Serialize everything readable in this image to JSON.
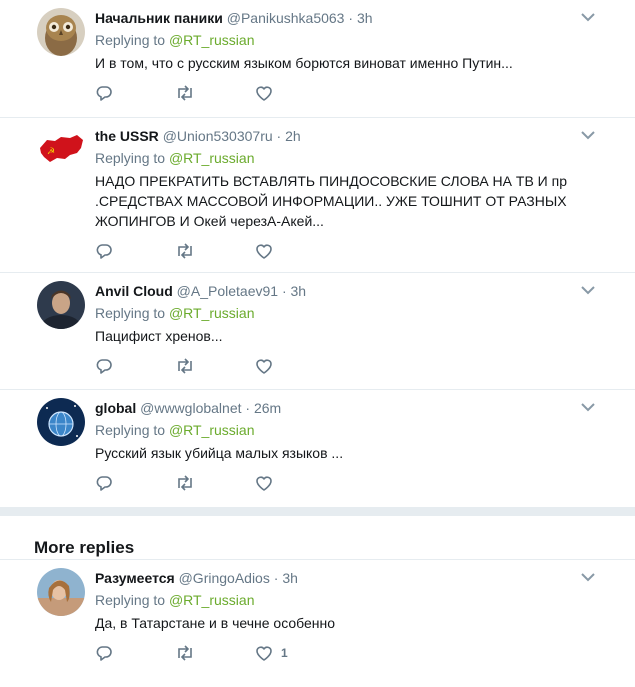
{
  "replies": [
    {
      "name": "Начальник паники",
      "handle": "@Panikushka5063",
      "time": "3h",
      "replying_label": "Replying to",
      "replying_to": "@RT_russian",
      "text": "И в том, что с русским языком борются виноват именно Путин...",
      "avatar": "owl-avatar",
      "like_count": ""
    },
    {
      "name": "the USSR",
      "handle": "@Union530307ru",
      "time": "2h",
      "replying_label": "Replying to",
      "replying_to": "@RT_russian",
      "text": "НАДО ПРЕКРАТИТЬ ВСТАВЛЯТЬ ПИНДОСОВСКИЕ СЛОВА НА ТВ И пр .СРЕДСТВАХ МАССОВОЙ ИНФОРМАЦИИ.. УЖЕ ТОШНИТ ОТ РАЗНЫХ ЖОПИНГОВ И Окей черезА-Акей...",
      "avatar": "ussr-map-avatar",
      "like_count": ""
    },
    {
      "name": "Anvil Cloud",
      "handle": "@A_Poletaev91",
      "time": "3h",
      "replying_label": "Replying to",
      "replying_to": "@RT_russian",
      "text": "Пацифист хренов...",
      "avatar": "person-photo-avatar",
      "like_count": ""
    },
    {
      "name": "global",
      "handle": "@wwwglobalnet",
      "time": "26m",
      "replying_label": "Replying to",
      "replying_to": "@RT_russian",
      "text": "Русский язык убийца малых языков ...",
      "avatar": "globe-avatar",
      "like_count": ""
    }
  ],
  "more_replies": {
    "title": "More replies",
    "items": [
      {
        "name": "Разумеется",
        "handle": "@GringoAdios",
        "time": "3h",
        "replying_label": "Replying to",
        "replying_to": "@RT_russian",
        "text": "Да, в Татарстане и в чечне особенно",
        "avatar": "woman-photo-avatar",
        "like_count": "1"
      }
    ]
  },
  "colors": {
    "link": "#6bab2d",
    "secondary_text": "#657786",
    "divider": "#e6ecf0",
    "icon": "#657786"
  },
  "icons": {
    "reply": "reply-icon",
    "retweet": "retweet-icon",
    "like": "heart-icon",
    "menu": "chevron-down-icon"
  }
}
